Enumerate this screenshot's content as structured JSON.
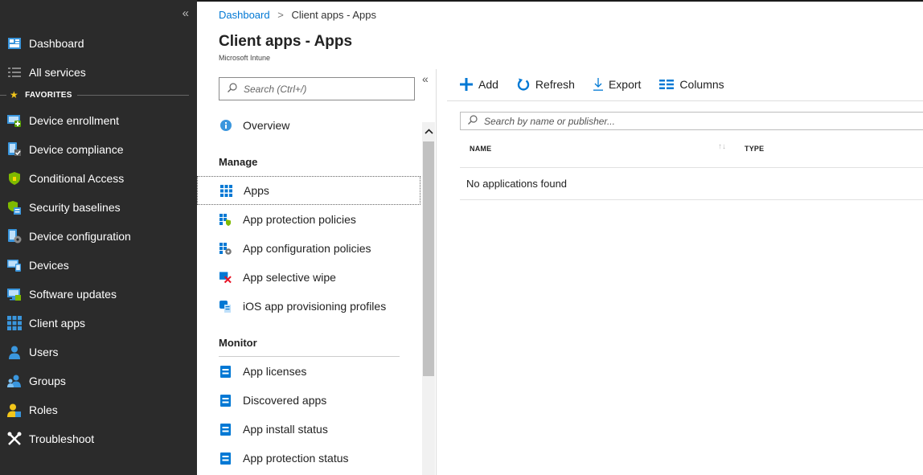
{
  "colors": {
    "nav_background": "#2b2b2b",
    "accent": "#0078d4",
    "favorite_star": "#f3c61a",
    "page_background": "#ffffff"
  },
  "nav": {
    "collapse_glyph": "«",
    "items": [
      {
        "label": "Dashboard",
        "icon": "dashboard-icon"
      },
      {
        "label": "All services",
        "icon": "list-icon"
      }
    ],
    "favorites_label": "FAVORITES",
    "favorites": [
      {
        "label": "Device enrollment",
        "icon": "device-enrollment-icon"
      },
      {
        "label": "Device compliance",
        "icon": "device-compliance-icon"
      },
      {
        "label": "Conditional Access",
        "icon": "shield-icon"
      },
      {
        "label": "Security baselines",
        "icon": "security-baselines-icon"
      },
      {
        "label": "Device configuration",
        "icon": "device-configuration-icon"
      },
      {
        "label": "Devices",
        "icon": "devices-icon"
      },
      {
        "label": "Software updates",
        "icon": "software-updates-icon"
      },
      {
        "label": "Client apps",
        "icon": "client-apps-icon"
      },
      {
        "label": "Users",
        "icon": "user-icon"
      },
      {
        "label": "Groups",
        "icon": "groups-icon"
      },
      {
        "label": "Roles",
        "icon": "roles-icon"
      },
      {
        "label": "Troubleshoot",
        "icon": "troubleshoot-icon"
      }
    ]
  },
  "breadcrumb": {
    "root": "Dashboard",
    "separator": ">",
    "current": "Client apps - Apps"
  },
  "page": {
    "title": "Client apps - Apps",
    "subtitle": "Microsoft Intune"
  },
  "blade": {
    "search_placeholder": "Search (Ctrl+/)",
    "collapse_glyph": "«",
    "overview": "Overview",
    "manage_label": "Manage",
    "manage_items": [
      "Apps",
      "App protection policies",
      "App configuration policies",
      "App selective wipe",
      "iOS app provisioning profiles"
    ],
    "monitor_label": "Monitor",
    "monitor_items": [
      "App licenses",
      "Discovered apps",
      "App install status",
      "App protection status"
    ]
  },
  "toolbar": {
    "add": "Add",
    "refresh": "Refresh",
    "export": "Export",
    "columns": "Columns"
  },
  "grid": {
    "search_placeholder": "Search by name or publisher...",
    "col_name": "NAME",
    "col_type": "TYPE",
    "empty_message": "No applications found"
  }
}
